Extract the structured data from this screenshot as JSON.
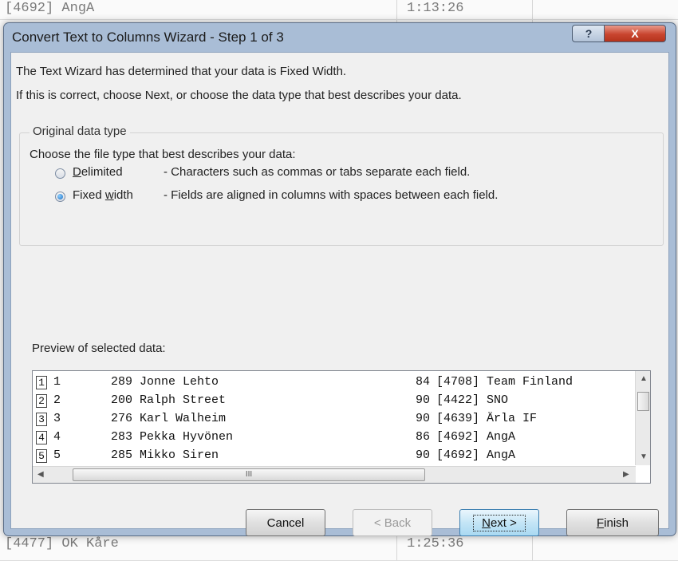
{
  "background_sheet": {
    "top_row": {
      "team": "[4692] AngA",
      "time": "1:13:26"
    },
    "bottom_row": {
      "team": "[4477] OK Kåre",
      "time": "1:25:36"
    }
  },
  "dialog": {
    "title": "Convert Text to Columns Wizard - Step 1 of 3",
    "help_label": "?",
    "close_label": "X",
    "intro_line1": "The Text Wizard has determined that your data is Fixed Width.",
    "intro_line2": "If this is correct, choose Next, or choose the data type that best describes your data.",
    "group_title": "Original data type",
    "group_prompt": "Choose the file type that best describes your data:",
    "options": [
      {
        "label_hot": "D",
        "label_rest": "elimited",
        "description": "- Characters such as commas or tabs separate each field.",
        "selected": false
      },
      {
        "label_pre": "Fixed ",
        "label_hot": "w",
        "label_rest": "idth",
        "description": "- Fields are aligned in columns with spaces between each field.",
        "selected": true
      }
    ],
    "preview_label": "Preview of selected data:",
    "preview_rows": [
      {
        "n": "1",
        "pos": "1",
        "bib": "289",
        "name": "Jonne Lehto",
        "age": "84",
        "club": "[4708] Team Finland"
      },
      {
        "n": "2",
        "pos": "2",
        "bib": "200",
        "name": "Ralph Street",
        "age": "90",
        "club": "[4422] SNO"
      },
      {
        "n": "3",
        "pos": "3",
        "bib": "276",
        "name": "Karl Walheim",
        "age": "90",
        "club": "[4639] Ärla IF"
      },
      {
        "n": "4",
        "pos": "4",
        "bib": "283",
        "name": "Pekka Hyvönen",
        "age": "86",
        "club": "[4692] AngA"
      },
      {
        "n": "5",
        "pos": "5",
        "bib": "285",
        "name": "Mikko Siren",
        "age": "90",
        "club": "[4692] AngA"
      }
    ],
    "scroll_grip": "III",
    "buttons": {
      "cancel": "Cancel",
      "back": "< Back",
      "next_hot": "N",
      "next_rest": "ext >",
      "finish_hot": "F",
      "finish_rest": "inish"
    }
  }
}
